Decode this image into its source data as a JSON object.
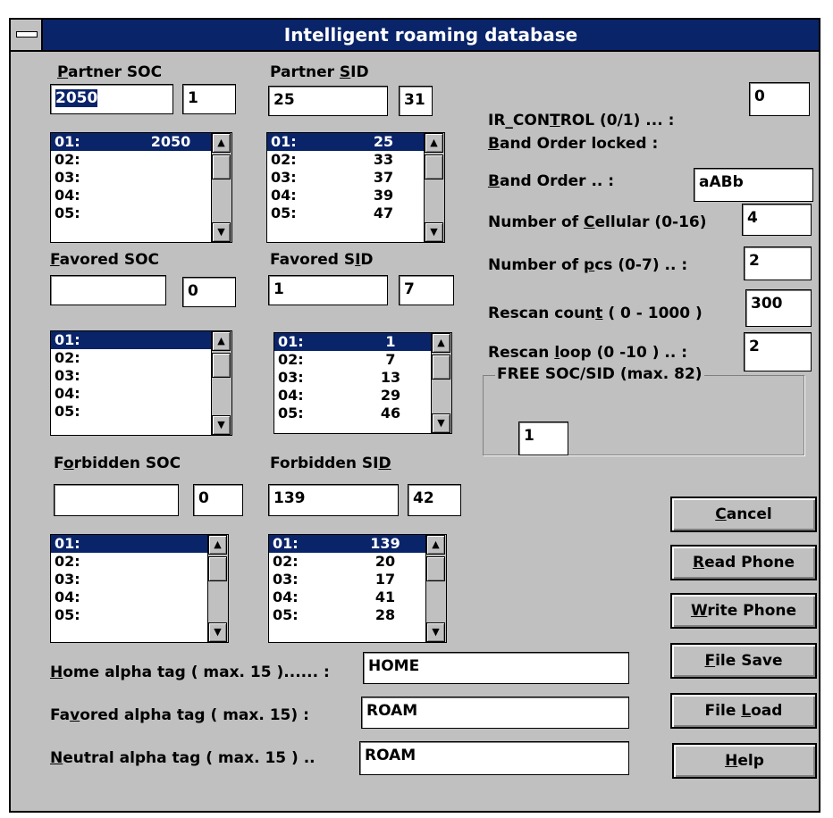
{
  "window": {
    "title": "Intelligent roaming database"
  },
  "partner_soc": {
    "label": "Partner SOC",
    "value": "2050",
    "count": "1",
    "list": [
      [
        "01:",
        "2050"
      ],
      [
        "02:",
        ""
      ],
      [
        "03:",
        ""
      ],
      [
        "04:",
        ""
      ],
      [
        "05:",
        ""
      ]
    ]
  },
  "partner_sid": {
    "label": "Partner SID",
    "value": "25",
    "count": "31",
    "list": [
      [
        "01:",
        "25"
      ],
      [
        "02:",
        "33"
      ],
      [
        "03:",
        "37"
      ],
      [
        "04:",
        "39"
      ],
      [
        "05:",
        "47"
      ]
    ]
  },
  "favored_soc": {
    "label": "Favored SOC",
    "value": "",
    "count": "0",
    "list": [
      [
        "01:",
        ""
      ],
      [
        "02:",
        ""
      ],
      [
        "03:",
        ""
      ],
      [
        "04:",
        ""
      ],
      [
        "05:",
        ""
      ]
    ]
  },
  "favored_sid": {
    "label": "Favored SID",
    "value": "1",
    "count": "7",
    "list": [
      [
        "01:",
        "1"
      ],
      [
        "02:",
        "7"
      ],
      [
        "03:",
        "13"
      ],
      [
        "04:",
        "29"
      ],
      [
        "05:",
        "46"
      ]
    ]
  },
  "forbidden_soc": {
    "label": "Forbidden SOC",
    "value": "",
    "count": "0",
    "list": [
      [
        "01:",
        ""
      ],
      [
        "02:",
        ""
      ],
      [
        "03:",
        ""
      ],
      [
        "04:",
        ""
      ],
      [
        "05:",
        ""
      ]
    ]
  },
  "forbidden_sid": {
    "label": "Forbidden SID",
    "value": "139",
    "count": "42",
    "list": [
      [
        "01:",
        "139"
      ],
      [
        "02:",
        "20"
      ],
      [
        "03:",
        "17"
      ],
      [
        "04:",
        "41"
      ],
      [
        "05:",
        "28"
      ]
    ]
  },
  "settings": {
    "ir_control_label": "IR_CONTROL (0/1) ... :",
    "ir_control": "0",
    "band_locked_label": "Band Order locked :",
    "band_order_label": "Band Order .. :",
    "band_order": "aABb",
    "cellular_label": "Number of Cellular  (0-16)",
    "cellular": "4",
    "pcs_label": "Number of pcs (0-7) ..  :",
    "pcs": "2",
    "rescan_count_label": "Rescan count  ( 0 - 1000 )",
    "rescan_count": "300",
    "rescan_loop_label": "Rescan loop (0 -10 ) .. :",
    "rescan_loop": "2",
    "free_label": "FREE SOC/SID (max. 82)",
    "free": "1"
  },
  "tags": {
    "home_label": "Home alpha tag ( max. 15 )...... :",
    "home": "HOME",
    "favored_label": "Favored  alpha tag ( max. 15) :",
    "favored": "ROAM",
    "neutral_label": "Neutral alpha tag ( max. 15 ) ..",
    "neutral": "ROAM"
  },
  "buttons": {
    "cancel": "Cancel",
    "read": "Read Phone",
    "write": "Write Phone",
    "save": "File Save",
    "load": "File Load",
    "help": "Help"
  },
  "icons": {
    "up": "up-arrow-icon",
    "down": "down-arrow-icon"
  }
}
